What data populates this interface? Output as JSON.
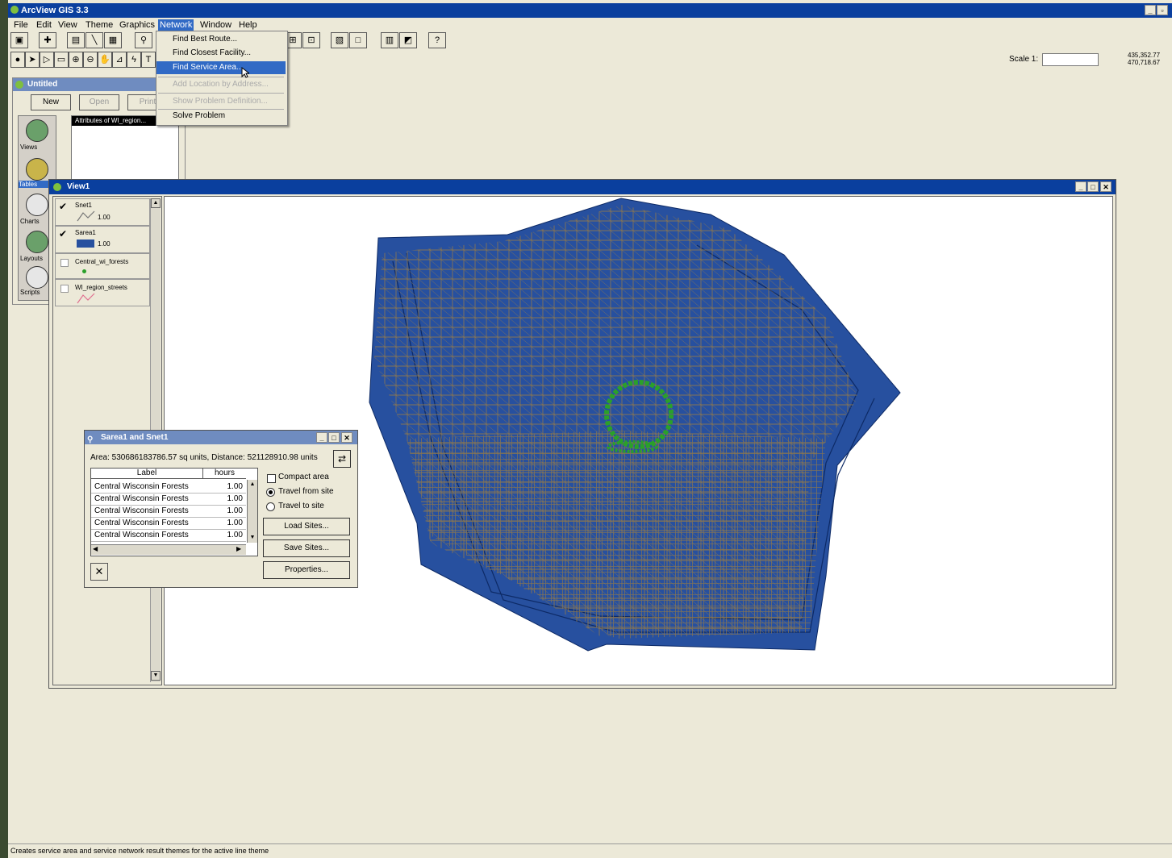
{
  "app": {
    "title": "ArcView GIS 3.3",
    "scale_label": "Scale 1:",
    "scale_value": "",
    "coords": [
      "435,352.77",
      "470,718.67"
    ]
  },
  "menubar": [
    "File",
    "Edit",
    "View",
    "Theme",
    "Graphics",
    "Network",
    "Window",
    "Help"
  ],
  "network_menu": [
    {
      "label": "Find Best Route...",
      "state": "normal"
    },
    {
      "label": "Find Closest Facility...",
      "state": "normal"
    },
    {
      "label": "Find Service Area...",
      "state": "highlighted"
    },
    {
      "label": "Add Location by Address...",
      "state": "disabled"
    },
    {
      "label": "Show Problem Definition...",
      "state": "disabled"
    },
    {
      "label": "Solve Problem",
      "state": "normal"
    }
  ],
  "project": {
    "title": "Untitled",
    "buttons": [
      "New",
      "Open",
      "Print"
    ],
    "doc_header": "Attributes of WI_region...",
    "doc_types": [
      "Views",
      "Tables",
      "Charts",
      "Layouts",
      "Scripts"
    ]
  },
  "view1": {
    "title": "View1",
    "legend": [
      {
        "name": "Snet1",
        "sub": "1.00",
        "checked": true
      },
      {
        "name": "Sarea1",
        "sub": "1.00",
        "checked": true
      },
      {
        "name": "Central_wi_forests",
        "sub": "",
        "checked": false
      },
      {
        "name": "WI_region_streets",
        "sub": "",
        "checked": false
      }
    ]
  },
  "dialog": {
    "title": "Sarea1 and Snet1",
    "summary": "Area: 530686183786.57 sq units, Distance: 521128910.98 units",
    "col_label": "Label",
    "col_hours": "hours",
    "rows": [
      {
        "label": "Central Wisconsin Forests",
        "hours": "1.00"
      },
      {
        "label": "Central Wisconsin Forests",
        "hours": "1.00"
      },
      {
        "label": "Central Wisconsin Forests",
        "hours": "1.00"
      },
      {
        "label": "Central Wisconsin Forests",
        "hours": "1.00"
      },
      {
        "label": "Central Wisconsin Forests",
        "hours": "1.00"
      }
    ],
    "options": [
      {
        "label": "Compact area",
        "kind": "checkbox",
        "selected": false
      },
      {
        "label": "Travel from site",
        "kind": "radio",
        "selected": true
      },
      {
        "label": "Travel to site",
        "kind": "radio",
        "selected": false
      }
    ],
    "buttons": [
      "Load Sites...",
      "Save Sites...",
      "Properties..."
    ]
  },
  "status": "Creates service area and service network result themes for the active line theme",
  "colors": {
    "service_area": "#27509f",
    "network": "#8a7650",
    "facility": "#2aa02a",
    "titlebar": "#0a3f9e"
  }
}
